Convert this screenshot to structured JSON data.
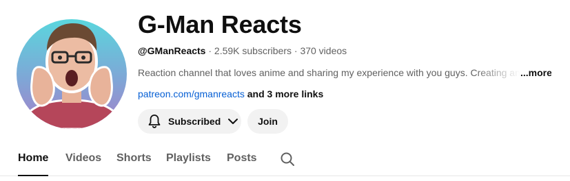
{
  "channel": {
    "title": "G-Man Reacts",
    "handle": "@GManReacts",
    "subscribers": "2.59K subscribers",
    "videos": "370 videos",
    "separator": " · ",
    "description": "Reaction channel that loves anime and sharing my experience with you guys. Creating and",
    "description_more": "...more",
    "link": "patreon.com/gmanreacts",
    "more_links": "and 3 more links"
  },
  "actions": {
    "subscribed_label": "Subscribed",
    "join_label": "Join"
  },
  "tabs": [
    {
      "label": "Home",
      "active": true
    },
    {
      "label": "Videos"
    },
    {
      "label": "Shorts"
    },
    {
      "label": "Playlists"
    },
    {
      "label": "Posts"
    }
  ],
  "icons": {
    "avatar": "channel-avatar-photo",
    "bell": "bell-icon",
    "chevron": "chevron-down-icon",
    "search": "search-icon"
  },
  "colors": {
    "link": "#065fd4",
    "button_bg": "#f2f2f2",
    "avatar_bg_top": "#56d4dc",
    "avatar_bg_bottom": "#a67fc9"
  }
}
